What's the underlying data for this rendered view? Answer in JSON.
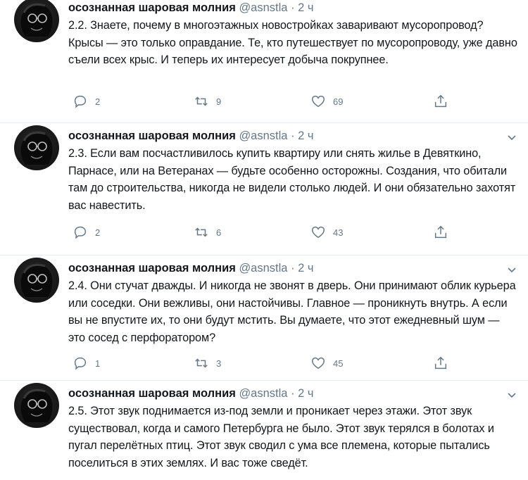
{
  "tweets": [
    {
      "author": "осознанная шаровая молния",
      "handle": "@asnstla",
      "separator": "·",
      "time": "2 ч",
      "text": "2.2. Знаете, почему в многоэтажных новостройках заваривают мусоропровод? Крысы — это только оправдание. Те, кто путешествует по мусоропроводу, уже давно съели всех крыс. И теперь их интересует добыча покрупнее.",
      "replies": "2",
      "retweets": "9",
      "likes": "69"
    },
    {
      "author": "осознанная шаровая молния",
      "handle": "@asnstla",
      "separator": "·",
      "time": "2 ч",
      "text": "2.3. Если вам посчастливилось купить квартиру или снять жилье в Девяткино, Парнасе, или на Ветеранах — будьте особенно осторожны. Создания, что обитали там до строительства, никогда не видели столько людей. И они обязательно захотят вас навестить.",
      "replies": "2",
      "retweets": "6",
      "likes": "43"
    },
    {
      "author": "осознанная шаровая молния",
      "handle": "@asnstla",
      "separator": "·",
      "time": "2 ч",
      "text": "2.4. Они стучат дважды. И никогда не звонят в дверь. Они принимают облик курьера или соседки. Они вежливы, они настойчивы. Главное — проникнуть внутрь. А если вы не впустите их, то они будут мстить. Вы думаете, что этот ежедневный шум — это сосед с перфоратором?",
      "replies": "1",
      "retweets": "3",
      "likes": "45"
    },
    {
      "author": "осознанная шаровая молния",
      "handle": "@asnstla",
      "separator": "·",
      "time": "2 ч",
      "text": "2.5. Этот звук поднимается из-под земли и проникает через этажи. Этот звук существовал, когда и самого Петербурга не было. Этот звук терялся в болотах и пугал перелётных птиц. Этот звук сводил с ума все племена, которые пытались поселиться в этих землях. И вас тоже сведёт."
    }
  ],
  "icons": {
    "reply": "reply-icon",
    "retweet": "retweet-icon",
    "like": "heart-icon",
    "share": "share-icon",
    "menu": "chevron-down-icon"
  },
  "colors": {
    "text": "#14171a",
    "secondary": "#657786",
    "divider": "#e6ecf0"
  }
}
